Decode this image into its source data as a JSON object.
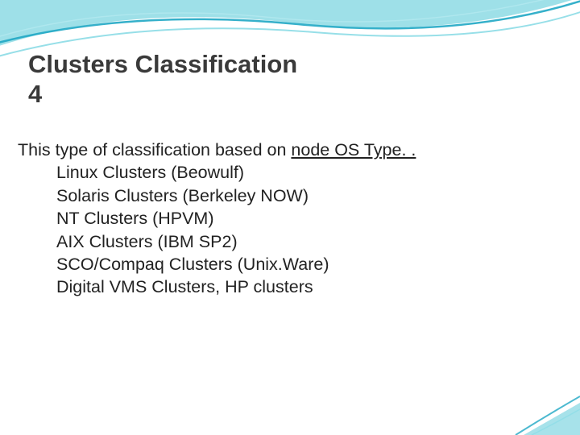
{
  "title_line1": "Clusters Classification",
  "title_line2": "4",
  "intro_prefix": "This type of classification based on ",
  "intro_underlined": "node OS Type. .",
  "items": [
    "Linux Clusters (Beowulf)",
    "Solaris Clusters  (Berkeley NOW)",
    "NT Clusters (HPVM)",
    "AIX Clusters (IBM SP2)",
    "SCO/Compaq Clusters (Unix.Ware)",
    "Digital VMS Clusters, HP clusters"
  ]
}
